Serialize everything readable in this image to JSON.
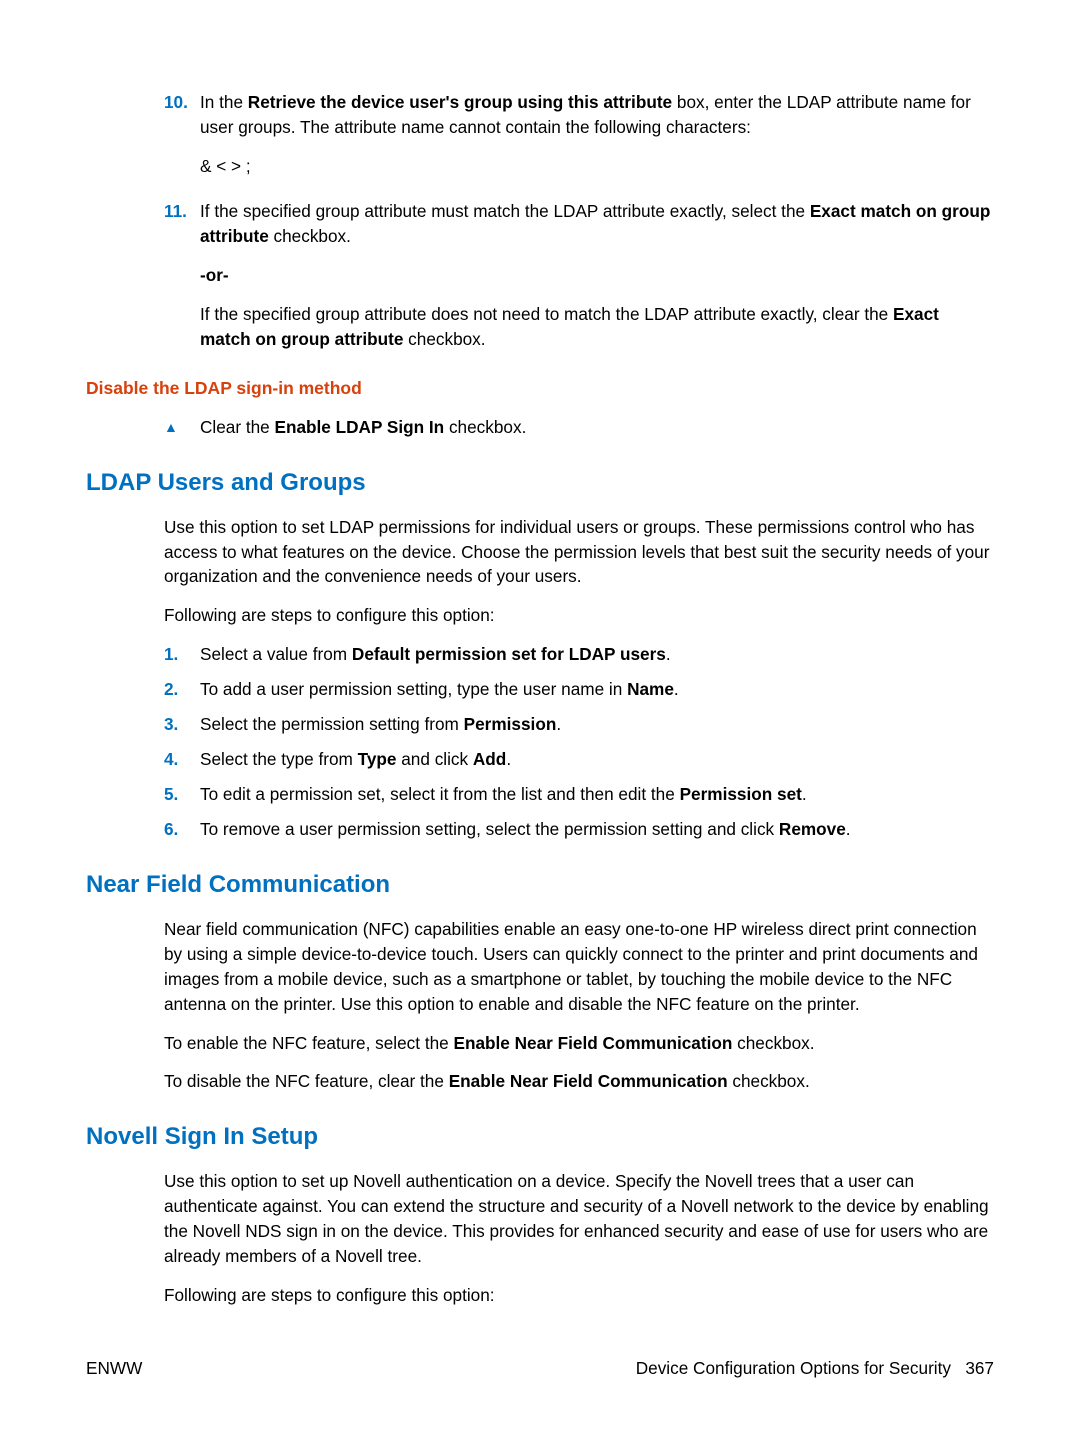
{
  "step10": {
    "num": "10.",
    "text_a": "In the ",
    "bold_a": "Retrieve the device user's group using this attribute",
    "text_b": " box, enter the LDAP attribute name for user groups. The attribute name cannot contain the following characters:",
    "chars": "& < > ;"
  },
  "step11": {
    "num": "11.",
    "text_a": "If the specified group attribute must match the LDAP attribute exactly, select the ",
    "bold_a": "Exact match on group attribute",
    "text_b": " checkbox.",
    "or": "-or-",
    "text_c": "If the specified group attribute does not need to match the LDAP attribute exactly, clear the ",
    "bold_b": "Exact match on group attribute",
    "text_d": " checkbox."
  },
  "disable_heading": "Disable the LDAP sign-in method",
  "disable_step": {
    "a": "Clear the ",
    "bold": "Enable LDAP Sign In",
    "b": " checkbox."
  },
  "ldap_heading": "LDAP Users and Groups",
  "ldap_intro": "Use this option to set LDAP permissions for individual users or groups. These permissions control who has access to what features on the device. Choose the permission levels that best suit the security needs of your organization and the convenience needs of your users.",
  "ldap_steps_intro": "Following are steps to configure this option:",
  "ldap_steps": [
    {
      "num": "1.",
      "a": "Select a value from ",
      "bold": "Default permission set for LDAP users",
      "b": "."
    },
    {
      "num": "2.",
      "a": "To add a user permission setting, type the user name in ",
      "bold": "Name",
      "b": "."
    },
    {
      "num": "3.",
      "a": "Select the permission setting from ",
      "bold": "Permission",
      "b": "."
    },
    {
      "num": "4.",
      "a": "Select the type from ",
      "bold": "Type",
      "b": " and click ",
      "bold2": "Add",
      "c": "."
    },
    {
      "num": "5.",
      "a": "To edit a permission set, select it from the list and then edit the ",
      "bold": "Permission set",
      "b": "."
    },
    {
      "num": "6.",
      "a": "To remove a user permission setting, select the permission setting and click ",
      "bold": "Remove",
      "b": "."
    }
  ],
  "nfc_heading": "Near Field Communication",
  "nfc_intro": "Near field communication (NFC) capabilities enable an easy one-to-one HP wireless direct print connection by using a simple device-to-device touch. Users can quickly connect to the printer and print documents and images from a mobile device, such as a smartphone or tablet, by touching the mobile device to the NFC antenna on the printer. Use this option to enable and disable the NFC feature on the printer.",
  "nfc_enable": {
    "a": "To enable the NFC feature, select the ",
    "bold": "Enable Near Field Communication",
    "b": " checkbox."
  },
  "nfc_disable": {
    "a": "To disable the NFC feature, clear the ",
    "bold": "Enable Near Field Communication",
    "b": " checkbox."
  },
  "novell_heading": "Novell Sign In Setup",
  "novell_intro": "Use this option to set up Novell authentication on a device. Specify the Novell trees that a user can authenticate against. You can extend the structure and security of a Novell network to the device by enabling the Novell NDS sign in on the device. This provides for enhanced security and ease of use for users who are already members of a Novell tree.",
  "novell_steps_intro": "Following are steps to configure this option:",
  "footer_left": "ENWW",
  "footer_right_a": "Device Configuration Options for Security",
  "footer_right_b": "367"
}
